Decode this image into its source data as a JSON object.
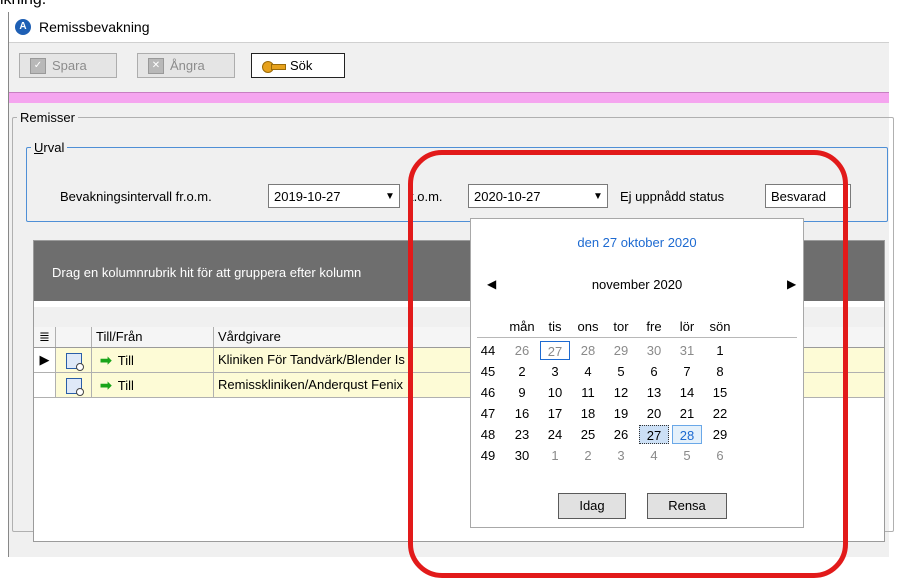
{
  "crop_text": "ikning.",
  "window": {
    "title": "Remissbevakning"
  },
  "toolbar": {
    "save": "Spara",
    "undo": "Ångra",
    "search": "Sök"
  },
  "remisser": {
    "legend": "Remisser",
    "urval": {
      "legend_prefix": "U",
      "legend_rest": "rval",
      "from_label": "Bevakningsintervall fr.o.m.",
      "from_value": "2019-10-27",
      "to_label": "t.o.m.",
      "to_value": "2020-10-27",
      "status_label": "Ej uppnådd status",
      "status_value": "Besvarad"
    }
  },
  "grid": {
    "group_hint": "Drag en kolumnrubrik hit för att gruppera efter kolumn",
    "headers": {
      "till_fran": "Till/Från",
      "vardgivare": "Vårdgivare"
    },
    "rows": [
      {
        "direction": "Till",
        "vardgivare": "Kliniken För Tandvärk/Blender Is"
      },
      {
        "direction": "Till",
        "vardgivare": "Remisskliniken/Anderqust Fenix"
      }
    ]
  },
  "calendar": {
    "today_text": "den 27 oktober 2020",
    "month_title": "november 2020",
    "weekdays": [
      "mån",
      "tis",
      "ons",
      "tor",
      "fre",
      "lör",
      "sön"
    ],
    "weeks": [
      {
        "num": "44",
        "days": [
          "26",
          "27",
          "28",
          "29",
          "30",
          "31",
          "1"
        ]
      },
      {
        "num": "45",
        "days": [
          "2",
          "3",
          "4",
          "5",
          "6",
          "7",
          "8"
        ]
      },
      {
        "num": "46",
        "days": [
          "9",
          "10",
          "11",
          "12",
          "13",
          "14",
          "15"
        ]
      },
      {
        "num": "47",
        "days": [
          "16",
          "17",
          "18",
          "19",
          "20",
          "21",
          "22"
        ]
      },
      {
        "num": "48",
        "days": [
          "23",
          "24",
          "25",
          "26",
          "27",
          "28",
          "29"
        ]
      },
      {
        "num": "49",
        "days": [
          "30",
          "1",
          "2",
          "3",
          "4",
          "5",
          "6"
        ]
      }
    ],
    "today_button": "Idag",
    "clear_button": "Rensa"
  },
  "colors": {
    "accent": "#1d6ad1",
    "highlight": "#e21a1a",
    "pinkbar": "#f5a5ef",
    "row_bg": "#fdfbd6"
  }
}
